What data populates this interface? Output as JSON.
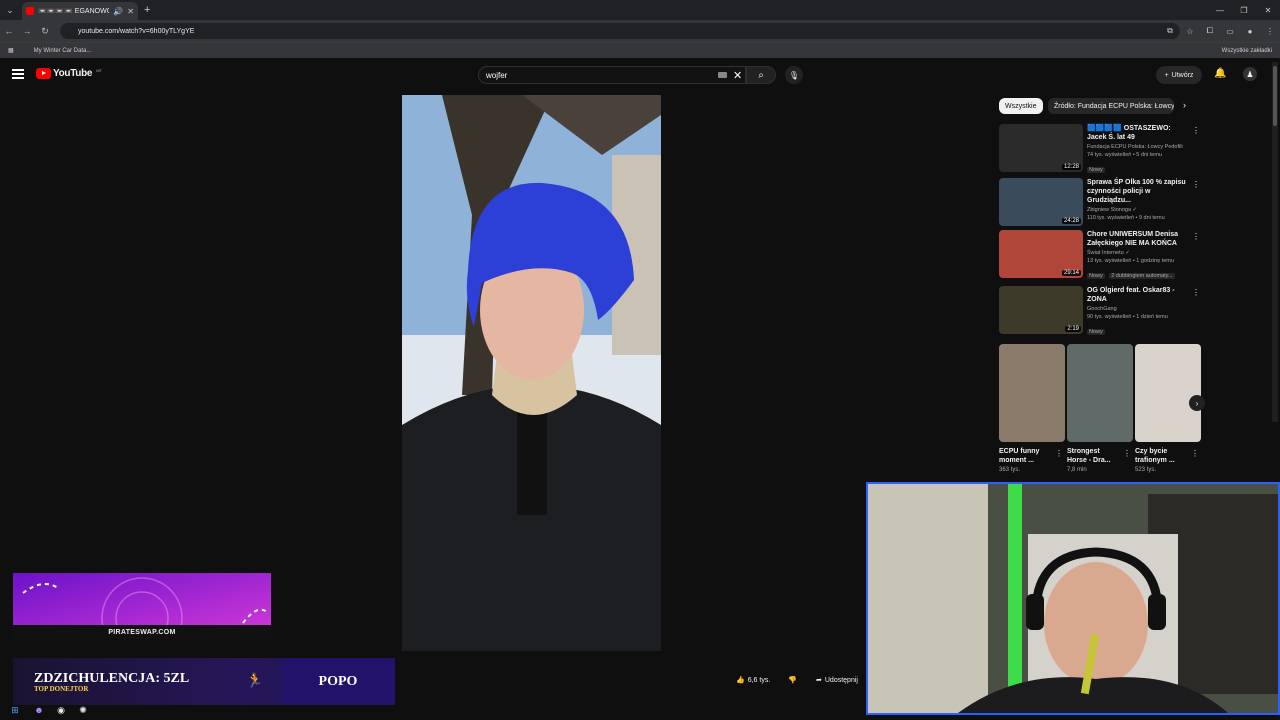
{
  "browser": {
    "tab_title": "📼📼📼📼 EGANOWO...",
    "url": "youtube.com/watch?v=6h00yTLYgYE",
    "bookmark_label": "My Winter Car Data...",
    "all_bookmarks_label": "Wszystkie zakładki"
  },
  "youtube": {
    "logo_text": "YouTube",
    "logo_country": "MT",
    "search_value": "wojfer",
    "create_label": "Utwórz"
  },
  "player": {
    "likes": "6,6 tys.",
    "share_label": "Udostępnij"
  },
  "chips": {
    "selected": "Wszystkie",
    "source": "Źródło: Fundacja ECPU Polska: Łowcy"
  },
  "recommendations": [
    {
      "title": "🟦🟦🟦🟦 OSTASZEWO: Jacek Ś. lat 49",
      "channel": "Fundacja ECPU Polska: Łowcy Pedofili",
      "stats": "74 tys. wyświetleń • 5 dni temu",
      "badge": "Nowy",
      "duration": "12:28",
      "color": "#2b2b2b"
    },
    {
      "title": "Sprawa ŚP Olka 100 % zapisu czynności policji w Grudziądzu...",
      "channel": "Zbigniew Stonoga ✓",
      "stats": "110 tys. wyświetleń • 9 dni temu",
      "badge": "",
      "duration": "24:28",
      "color": "#3a4b5c"
    },
    {
      "title": "Chore UNIWERSUM Denisa Załęckiego NIE MA KOŃCA",
      "channel": "Świat Internetu ✓",
      "stats": "13 tys. wyświetleń • 1 godzinę temu",
      "badge": "Nowy",
      "badge2": "2 dubbingiem automaty...",
      "duration": "29:14",
      "color": "#b0453a"
    },
    {
      "title": "OG Olgierd feat. Oskar83 - ZONA",
      "channel": "GoochGang",
      "stats": "90 tys. wyświetleń • 1 dzień temu",
      "badge": "Nowy",
      "duration": "2:19",
      "color": "#3d3a2a"
    }
  ],
  "shorts": [
    {
      "title": "ECPU funny moment ...",
      "views": "363 tys.",
      "color": "#8a7a6a"
    },
    {
      "title": "Strongest Horse - Dra...",
      "views": "7,8 mln",
      "color": "#606a68"
    },
    {
      "title": "Czy bycie trafionym ...",
      "views": "523 tys.",
      "color": "#d9d3cc"
    }
  ],
  "overlay": {
    "banner_url": "PIRATESWAP.COM",
    "donation_main": "ZDZICHULENCJA: 5ZL",
    "donation_sub": "TOP DONEJTOR",
    "donor_name": "POPO"
  }
}
